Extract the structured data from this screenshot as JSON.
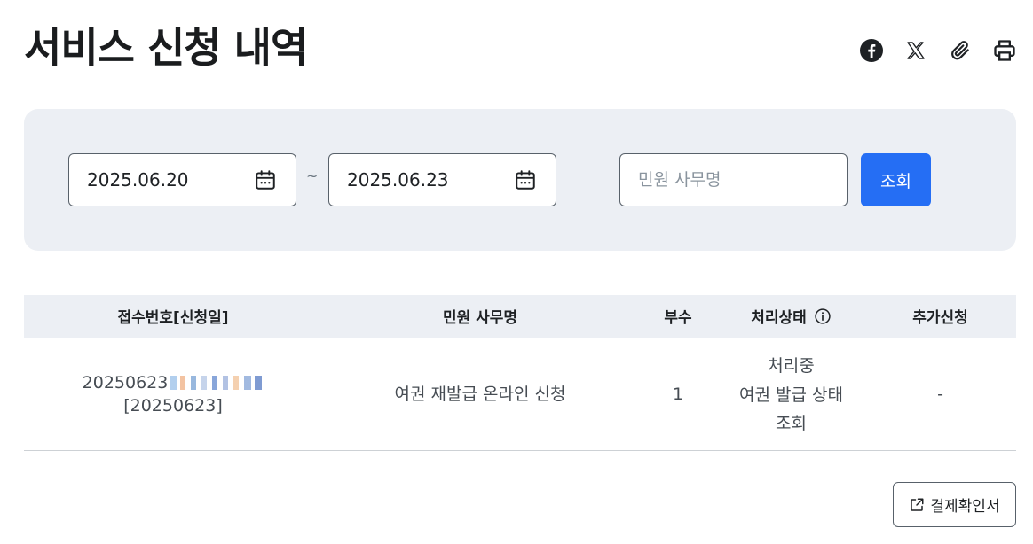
{
  "page": {
    "title": "서비스 신청 내역"
  },
  "share": [
    {
      "icon": "facebook-icon"
    },
    {
      "icon": "x-twitter-icon"
    },
    {
      "icon": "paperclip-icon"
    },
    {
      "icon": "printer-icon"
    }
  ],
  "search": {
    "date_from": "2025.06.20",
    "date_to": "2025.06.23",
    "tilde": "~",
    "name_placeholder": "민원 사무명",
    "name_value": "",
    "button_label": "조회"
  },
  "table": {
    "headers": [
      "접수번호[신청일]",
      "민원 사무명",
      "부수",
      "처리상태",
      "추가신청"
    ],
    "rows": [
      {
        "receipt_no": "20250623",
        "apply_date": "[20250623]",
        "service_name": "여권 재발급 온라인 신청",
        "copies": "1",
        "status": "처리중",
        "status_link_line1": "여권 발급 상태",
        "status_link_line2": "조회",
        "additional": "-"
      }
    ]
  },
  "footer": {
    "receipt_button_label": "결제확인서"
  },
  "colors": {
    "accent": "#256ef4",
    "panel_bg": "#eceff4",
    "border": "#58616a"
  }
}
